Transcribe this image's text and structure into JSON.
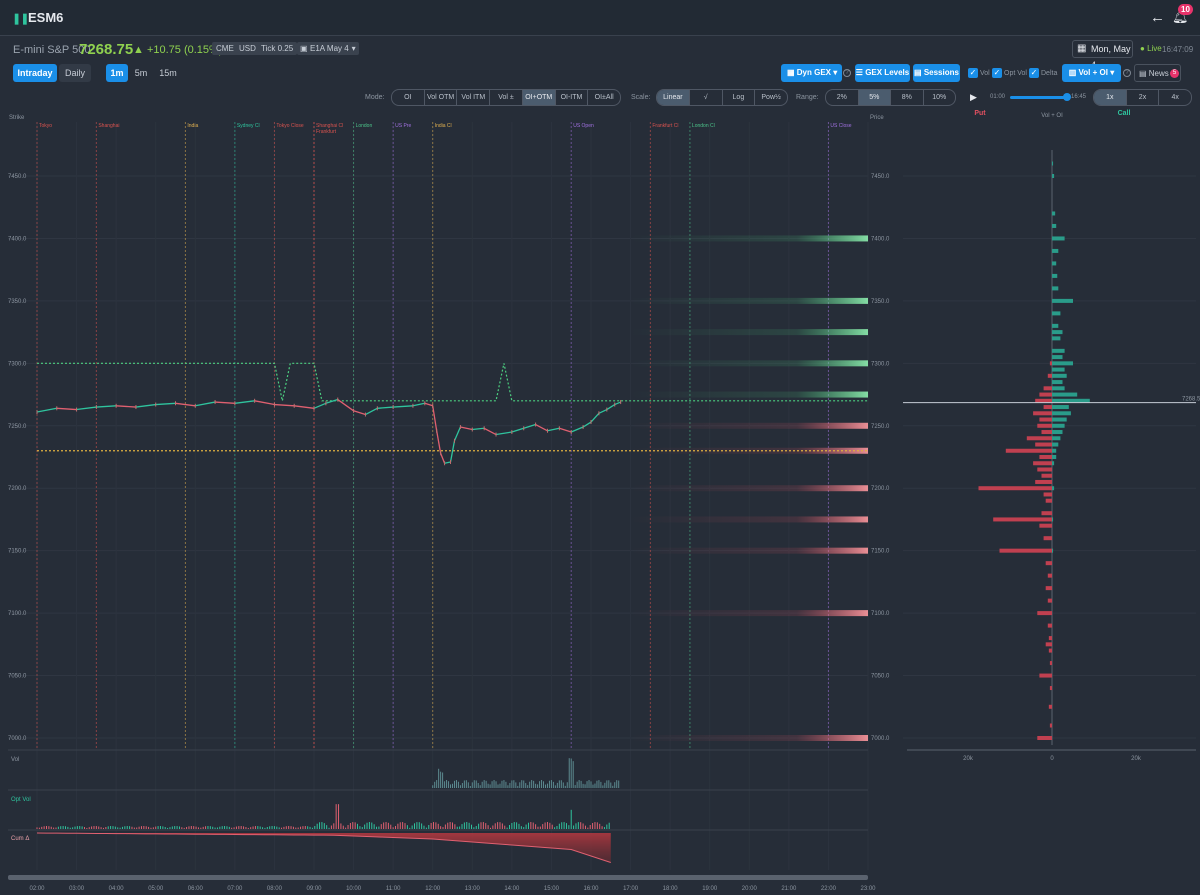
{
  "header": {
    "symbol": "ESM6",
    "notifications": "10"
  },
  "quote": {
    "name": "E-mini S&P 500",
    "price": "7268.75",
    "change": "+10.75 (0.15%)",
    "tags": [
      "CME",
      "USD",
      "Tick 0.25"
    ],
    "contract": "E1A May 4",
    "date": "Mon, May 4",
    "live_label": "Live",
    "live_time": "16:47:09"
  },
  "controls": {
    "intraday": "Intraday",
    "daily": "Daily",
    "intervals": [
      "1m",
      "5m",
      "15m"
    ],
    "dyn_gex": "Dyn GEX",
    "gex_levels": "GEX Levels",
    "sessions": "Sessions",
    "checks": [
      "Vol",
      "Opt Vol",
      "Delta"
    ],
    "vol_oi": "Vol + OI",
    "news": "News",
    "news_count": "5"
  },
  "mode": {
    "label": "Mode:",
    "options": [
      "OI",
      "Vol OTM",
      "Vol ITM",
      "Vol ±",
      "OI+OTM",
      "OI-ITM",
      "OI±All"
    ],
    "active": "OI+OTM"
  },
  "scale": {
    "label": "Scale:",
    "options": [
      "Linear",
      "√",
      "Log",
      "Pow½"
    ],
    "active": "Linear"
  },
  "range": {
    "label": "Range:",
    "options": [
      "2%",
      "5%",
      "8%",
      "10%"
    ],
    "active": "5%"
  },
  "playback": {
    "start": "01:00",
    "end": "16:45",
    "speeds": [
      "1x",
      "2x",
      "4x"
    ],
    "active": "1x"
  },
  "chart_data": {
    "type": "line",
    "ylabel": "Strike",
    "ylim": [
      6990,
      7475
    ],
    "y_ticks": [
      7450,
      7400,
      7350,
      7300,
      7250,
      7200,
      7150,
      7100,
      7050,
      7000
    ],
    "y_tick_labels": [
      "7450.0",
      "7400.0",
      "7350.0",
      "7300.0",
      "7250.0",
      "7200.0",
      "7150.0",
      "7100.0",
      "7050.0",
      "7000.0"
    ],
    "right_axis_label": "Price",
    "x_ticks": [
      "02:00",
      "03:00",
      "04:00",
      "05:00",
      "06:00",
      "07:00",
      "08:00",
      "09:00",
      "10:00",
      "11:00",
      "12:00",
      "13:00",
      "14:00",
      "15:00",
      "16:00",
      "17:00",
      "18:00",
      "19:00",
      "20:00",
      "21:00",
      "22:00",
      "23:00"
    ],
    "sessions": [
      {
        "label": "Tokyo",
        "t": 2.0,
        "color": "#d9534f"
      },
      {
        "label": "Shanghai",
        "t": 3.5,
        "color": "#d9534f"
      },
      {
        "label": "India",
        "t": 5.75,
        "color": "#e0b050"
      },
      {
        "label": "Sydney Cl",
        "t": 7.0,
        "color": "#2fc49e"
      },
      {
        "label": "Tokyo Close",
        "t": 8.0,
        "color": "#d9534f"
      },
      {
        "label": "Shanghai Cl",
        "t": 9.0,
        "color": "#d9534f"
      },
      {
        "label": "Frankfurt",
        "t": 9.0,
        "color": "#d9534f"
      },
      {
        "label": "London",
        "t": 10.0,
        "color": "#4cc38a"
      },
      {
        "label": "US Pre",
        "t": 11.0,
        "color": "#a070e0"
      },
      {
        "label": "India Cl",
        "t": 12.0,
        "color": "#e0b050"
      },
      {
        "label": "US Open",
        "t": 15.5,
        "color": "#a070e0"
      },
      {
        "label": "Frankfurt Cl",
        "t": 17.5,
        "color": "#d9534f"
      },
      {
        "label": "London Cl",
        "t": 18.5,
        "color": "#4cc38a"
      },
      {
        "label": "US Close",
        "t": 22.0,
        "color": "#a070e0"
      }
    ],
    "price_series": [
      [
        2.0,
        7261
      ],
      [
        2.5,
        7264
      ],
      [
        3.0,
        7263
      ],
      [
        3.5,
        7265
      ],
      [
        4.0,
        7266
      ],
      [
        4.5,
        7265
      ],
      [
        5.0,
        7267
      ],
      [
        5.5,
        7268
      ],
      [
        6.0,
        7266
      ],
      [
        6.5,
        7269
      ],
      [
        7.0,
        7268
      ],
      [
        7.5,
        7270
      ],
      [
        8.0,
        7267
      ],
      [
        8.5,
        7266
      ],
      [
        9.0,
        7264
      ],
      [
        9.3,
        7268
      ],
      [
        9.6,
        7271
      ],
      [
        10.0,
        7262
      ],
      [
        10.3,
        7259
      ],
      [
        10.6,
        7264
      ],
      [
        11.0,
        7265
      ],
      [
        11.5,
        7266
      ],
      [
        11.8,
        7268
      ],
      [
        12.0,
        7266
      ],
      [
        12.1,
        7246
      ],
      [
        12.2,
        7228
      ],
      [
        12.3,
        7220
      ],
      [
        12.45,
        7221
      ],
      [
        12.55,
        7238
      ],
      [
        12.7,
        7249
      ],
      [
        13.0,
        7247
      ],
      [
        13.3,
        7248
      ],
      [
        13.6,
        7243
      ],
      [
        14.0,
        7245
      ],
      [
        14.3,
        7248
      ],
      [
        14.6,
        7251
      ],
      [
        14.9,
        7246
      ],
      [
        15.2,
        7248
      ],
      [
        15.5,
        7245
      ],
      [
        15.8,
        7249
      ],
      [
        16.0,
        7253
      ],
      [
        16.2,
        7260
      ],
      [
        16.4,
        7263
      ],
      [
        16.6,
        7267
      ],
      [
        16.75,
        7269
      ]
    ],
    "call_wall_series": [
      [
        2.0,
        7300
      ],
      [
        8.0,
        7300
      ],
      [
        8.2,
        7270
      ],
      [
        8.4,
        7300
      ],
      [
        9.0,
        7300
      ],
      [
        9.2,
        7270
      ],
      [
        13.6,
        7270
      ],
      [
        13.8,
        7300
      ],
      [
        14.0,
        7270
      ],
      [
        23.0,
        7270
      ]
    ],
    "put_wall": 7230,
    "gex_call_levels": [
      7400,
      7350,
      7325,
      7300,
      7275
    ],
    "gex_put_levels": [
      7250,
      7230,
      7200,
      7175,
      7150,
      7100,
      7000
    ],
    "profile": {
      "title": "Vol + OI",
      "put_label": "Put",
      "call_label": "Call",
      "x_ticks": [
        "20k",
        "0",
        "20k"
      ],
      "current_price": 7268.5,
      "current_price_label": "7268.5",
      "calls": [
        [
          7460,
          0.5
        ],
        [
          7450,
          1
        ],
        [
          7420,
          1.5
        ],
        [
          7410,
          2
        ],
        [
          7400,
          6
        ],
        [
          7390,
          3
        ],
        [
          7380,
          2
        ],
        [
          7370,
          2.5
        ],
        [
          7360,
          3
        ],
        [
          7350,
          10
        ],
        [
          7340,
          4
        ],
        [
          7330,
          3
        ],
        [
          7325,
          5
        ],
        [
          7320,
          4
        ],
        [
          7310,
          6
        ],
        [
          7305,
          5
        ],
        [
          7300,
          10
        ],
        [
          7295,
          6
        ],
        [
          7290,
          7
        ],
        [
          7285,
          5
        ],
        [
          7280,
          6
        ],
        [
          7275,
          12
        ],
        [
          7270,
          18
        ],
        [
          7265,
          8
        ],
        [
          7260,
          9
        ],
        [
          7255,
          7
        ],
        [
          7250,
          6
        ],
        [
          7245,
          5
        ],
        [
          7240,
          4
        ],
        [
          7235,
          3
        ],
        [
          7230,
          2
        ],
        [
          7225,
          2
        ],
        [
          7220,
          1
        ],
        [
          7200,
          1
        ],
        [
          7175,
          0.5
        ],
        [
          7150,
          0.5
        ]
      ],
      "puts": [
        [
          7300,
          1
        ],
        [
          7290,
          2
        ],
        [
          7280,
          4
        ],
        [
          7275,
          6
        ],
        [
          7270,
          8
        ],
        [
          7265,
          4
        ],
        [
          7260,
          9
        ],
        [
          7255,
          6
        ],
        [
          7250,
          7
        ],
        [
          7245,
          5
        ],
        [
          7240,
          12
        ],
        [
          7235,
          8
        ],
        [
          7230,
          22
        ],
        [
          7225,
          6
        ],
        [
          7220,
          9
        ],
        [
          7215,
          7
        ],
        [
          7210,
          5
        ],
        [
          7205,
          8
        ],
        [
          7200,
          35
        ],
        [
          7195,
          4
        ],
        [
          7190,
          3
        ],
        [
          7180,
          5
        ],
        [
          7175,
          28
        ],
        [
          7170,
          6
        ],
        [
          7160,
          4
        ],
        [
          7150,
          25
        ],
        [
          7140,
          3
        ],
        [
          7130,
          2
        ],
        [
          7120,
          3
        ],
        [
          7110,
          2
        ],
        [
          7100,
          7
        ],
        [
          7090,
          2
        ],
        [
          7080,
          1.5
        ],
        [
          7075,
          3
        ],
        [
          7070,
          1.5
        ],
        [
          7060,
          1
        ],
        [
          7050,
          6
        ],
        [
          7040,
          1
        ],
        [
          7025,
          1.5
        ],
        [
          7010,
          1
        ],
        [
          7000,
          7
        ]
      ]
    },
    "subpanels": [
      {
        "label": "Vol"
      },
      {
        "label": "Opt Vol"
      },
      {
        "label": "Cum Δ"
      }
    ]
  }
}
